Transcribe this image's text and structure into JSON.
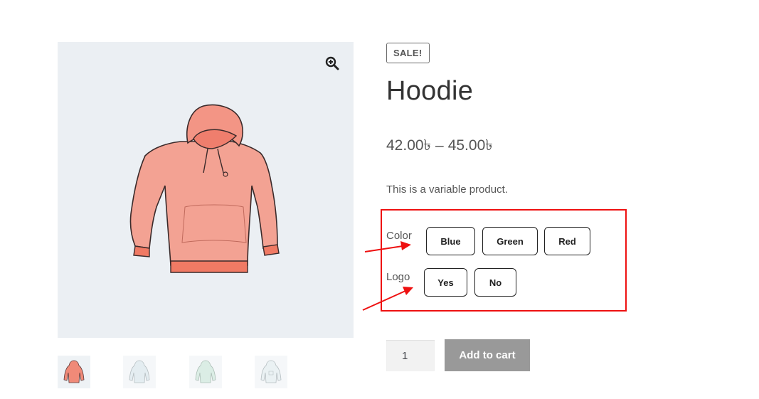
{
  "gallery": {
    "zoom_icon": "magnifier-plus-icon",
    "main_image_alt": "hoodie-image",
    "thumbnails": [
      {
        "icon": "hoodie-thumbnail",
        "color": "#f08a78",
        "selected": true
      },
      {
        "icon": "hoodie-thumbnail",
        "color": "#cfe0e6",
        "selected": false
      },
      {
        "icon": "hoodie-thumbnail",
        "color": "#bfe0d0",
        "selected": false
      },
      {
        "icon": "hoodie-thumbnail",
        "color": "#d9e6ea",
        "selected": false
      }
    ]
  },
  "product": {
    "badge": "SALE!",
    "title": "Hoodie",
    "price_min": "42.00৳",
    "price_separator": "–",
    "price_max": "45.00৳",
    "description": "This is a variable product."
  },
  "variations": {
    "color": {
      "label": "Color",
      "options": [
        "Blue",
        "Green",
        "Red"
      ]
    },
    "logo": {
      "label": "Logo",
      "options": [
        "Yes",
        "No"
      ]
    }
  },
  "cart": {
    "quantity": "1",
    "add_to_cart_label": "Add to cart"
  },
  "colors": {
    "annotation": "#ee1111",
    "gallery_background": "#ebeff3",
    "button_disabled": "#999999",
    "hoodie": "#f3a293"
  }
}
